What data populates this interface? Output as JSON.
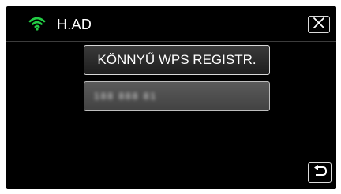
{
  "header": {
    "network_name": "H.AD",
    "wifi_icon": "wifi-signal-icon",
    "close_icon": "close-x-icon"
  },
  "menu": {
    "wps_label": "KÖNNYŰ WPS REGISTR.",
    "pin_value": "188 888 81"
  },
  "footer": {
    "back_icon": "return-arrow-icon"
  },
  "colors": {
    "background": "#000000",
    "wifi_green": "#22cc44",
    "button_border": "#d8d8d8",
    "text": "#ffffff"
  }
}
